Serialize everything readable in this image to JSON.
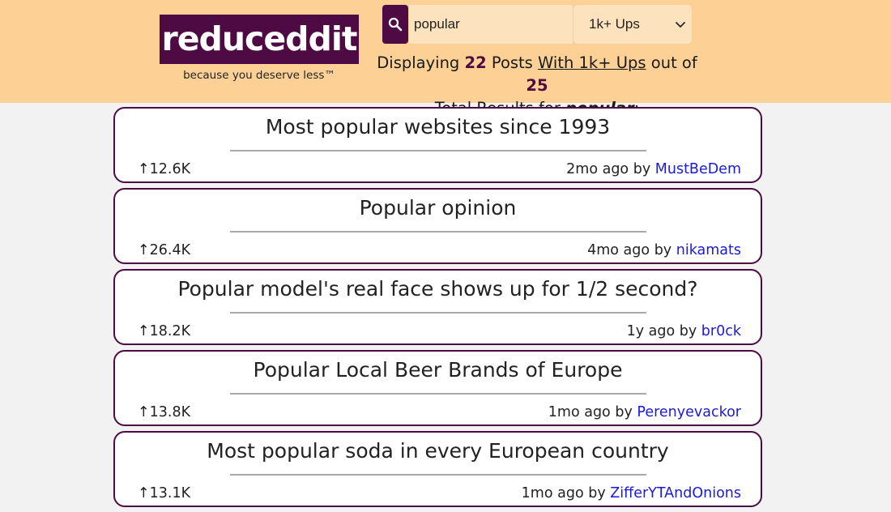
{
  "header": {
    "logo_text": "reduceddit",
    "tagline": "because you deserve less™",
    "search_value": "popular",
    "ups_filter": "1k+ Ups",
    "summary": {
      "prefix": "Displaying",
      "shown_count": "22",
      "posts_word": "Posts",
      "filter_text": "With 1k+ Ups",
      "out_of": "out of",
      "total_count": "25",
      "total_results": "Total Results for",
      "query": "popular",
      "colon": ":"
    }
  },
  "icons": {
    "search": "search-icon",
    "dropdown": "chevron-down-icon"
  },
  "colors": {
    "brand": "#4e0b43",
    "header_bg": "#fdd196",
    "link": "#1a1adb",
    "page_bg": "#f2f2f2"
  },
  "posts": [
    {
      "title": "Most popular websites since 1993",
      "ups": "↑12.6K",
      "age": "2mo ago",
      "by": "by",
      "author": "MustBeDem"
    },
    {
      "title": "Popular opinion",
      "ups": "↑26.4K",
      "age": "4mo ago",
      "by": "by",
      "author": "nikamats"
    },
    {
      "title": "Popular model's real face shows up for 1/2 second?",
      "ups": "↑18.2K",
      "age": "1y ago",
      "by": "by",
      "author": "br0ck"
    },
    {
      "title": "Popular Local Beer Brands of Europe",
      "ups": "↑13.8K",
      "age": "1mo ago",
      "by": "by",
      "author": "Perenyevackor"
    },
    {
      "title": "Most popular soda in every European country",
      "ups": "↑13.1K",
      "age": "1mo ago",
      "by": "by",
      "author": "ZifferYTAndOnions"
    }
  ]
}
